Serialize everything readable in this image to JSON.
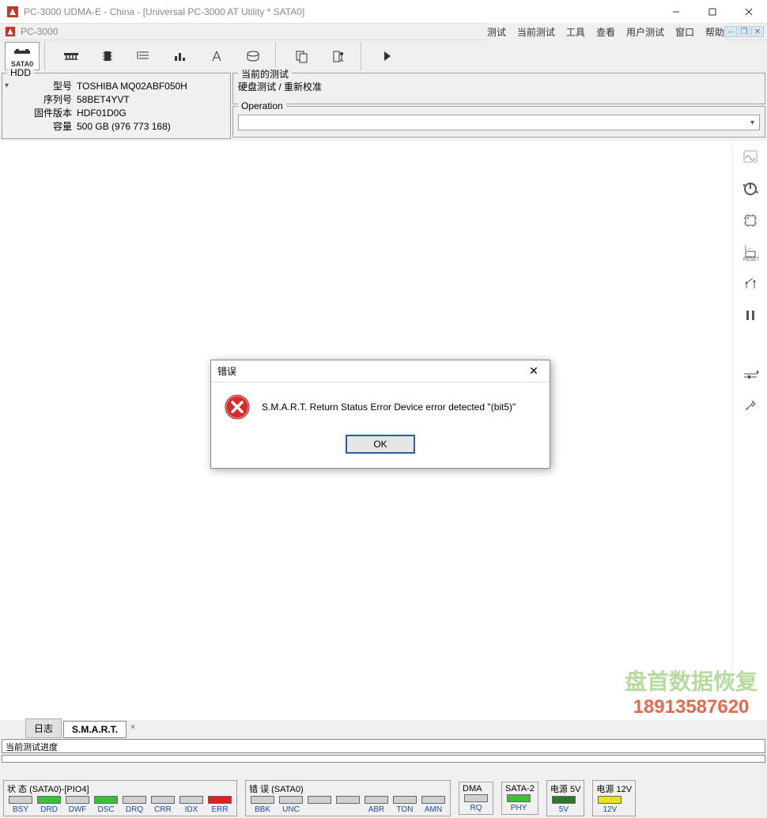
{
  "outerTitle": "PC-3000 UDMA-E - China - [Universal PC-3000 AT Utility * SATA0]",
  "innerTitle": "PC-3000",
  "menu": {
    "m1": "测试",
    "m2": "当前测试",
    "m3": "工具",
    "m4": "查看",
    "m5": "用户测试",
    "m6": "窗口",
    "m7": "帮助"
  },
  "toolbar": {
    "sata": "SATA0"
  },
  "hdd": {
    "legend": "HDD",
    "l_model": "型号",
    "v_model": "TOSHIBA MQ02ABF050H",
    "l_serial": "序列号",
    "v_serial": "58BET4YVT",
    "l_fw": "固件版本",
    "v_fw": "HDF01D0G",
    "l_cap": "容量",
    "v_cap": "500 GB (976 773 168)"
  },
  "currentTest": {
    "legend": "当前的测试",
    "value": "硬盘测试 / 重新校准"
  },
  "operation": {
    "legend": "Operation",
    "value": ""
  },
  "tabs": {
    "t1": "日志",
    "t2": "S.M.A.R.T."
  },
  "progress": {
    "label": "当前测试进度"
  },
  "dialog": {
    "title": "错误",
    "message": "S.M.A.R.T. Return Status Error Device error detected \"(bit5)\"",
    "ok": "OK"
  },
  "status": {
    "g1_label": "状 态 (SATA0)-[PIO4]",
    "g1": [
      "BSY",
      "DRD",
      "DWF",
      "DSC",
      "DRQ",
      "CRR",
      "IDX",
      "ERR"
    ],
    "g1_colors": [
      "gray",
      "green",
      "gray",
      "green",
      "gray",
      "gray",
      "gray",
      "red"
    ],
    "g2_label": "错 误 (SATA0)",
    "g2": [
      "BBK",
      "UNC",
      "",
      "",
      "ABR",
      "TON",
      "AMN"
    ],
    "g2_colors": [
      "gray",
      "gray",
      "gray",
      "gray",
      "gray",
      "gray",
      "gray"
    ],
    "g3_label": "DMA",
    "g3": [
      "RQ"
    ],
    "g3_colors": [
      "gray"
    ],
    "g4_label": "SATA-2",
    "g4": [
      "PHY"
    ],
    "g4_colors": [
      "green"
    ],
    "g5_label": "电源 5V",
    "g5": [
      "5V"
    ],
    "g5_colors": [
      "darkgreen"
    ],
    "g6_label": "电源 12V",
    "g6": [
      "12V"
    ],
    "g6_colors": [
      "yellow"
    ]
  },
  "watermark": {
    "line1": "盘首数据恢复",
    "line2": "18913587620"
  }
}
